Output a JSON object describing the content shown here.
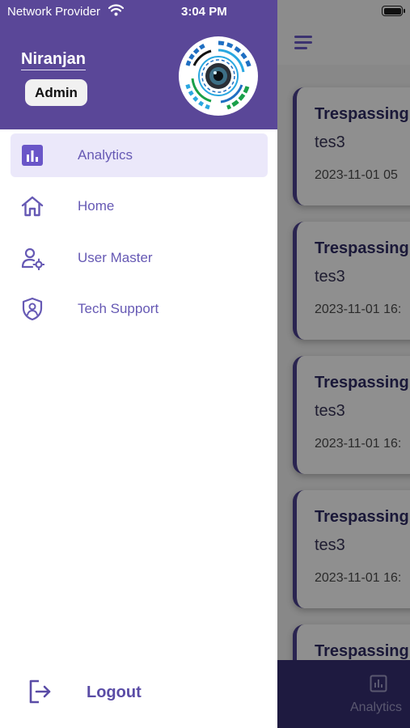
{
  "status_bar": {
    "carrier": "Network Provider",
    "time": "3:04 PM"
  },
  "drawer": {
    "user_name": "Niranjan",
    "role": "Admin",
    "menu": [
      {
        "label": "Analytics",
        "icon": "analytics-icon",
        "active": true
      },
      {
        "label": "Home",
        "icon": "home-icon",
        "active": false
      },
      {
        "label": "User Master",
        "icon": "user-settings-icon",
        "active": false
      },
      {
        "label": "Tech Support",
        "icon": "shield-user-icon",
        "active": false
      }
    ],
    "logout_label": "Logout"
  },
  "background": {
    "cards": [
      {
        "title": "Trespassing",
        "subtitle": "tes3",
        "date": "2023-11-01 05"
      },
      {
        "title": "Trespassing",
        "subtitle": "tes3",
        "date": "2023-11-01 16:"
      },
      {
        "title": "Trespassing",
        "subtitle": "tes3",
        "date": "2023-11-01 16:"
      },
      {
        "title": "Trespassing",
        "subtitle": "tes3",
        "date": "2023-11-01 16:"
      },
      {
        "title": "Trespassing",
        "subtitle": "",
        "date": ""
      }
    ],
    "tab_label": "Analytics"
  },
  "colors": {
    "accent": "#5a4798",
    "active_bg": "#ebe8fa",
    "label": "#6659b4",
    "tabbar": "#1e1a40"
  }
}
